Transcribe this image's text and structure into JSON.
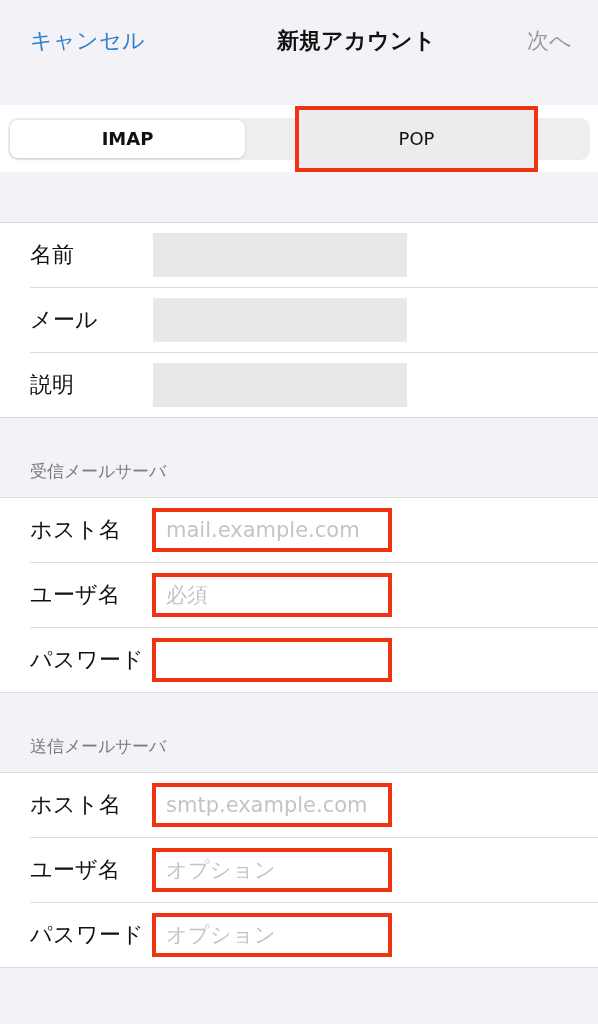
{
  "nav": {
    "cancel": "キャンセル",
    "title": "新規アカウント",
    "next": "次へ",
    "next_disabled": true
  },
  "segments": [
    {
      "label": "IMAP",
      "selected": true,
      "highlighted": false
    },
    {
      "label": "POP",
      "selected": false,
      "highlighted": true
    }
  ],
  "sections": [
    {
      "rows": [
        {
          "label": "名前",
          "redacted": true,
          "highlighted": false
        },
        {
          "label": "メール",
          "redacted": true,
          "highlighted": false
        },
        {
          "label": "説明",
          "redacted": true,
          "highlighted": false
        }
      ]
    },
    {
      "header": "受信メールサーバ",
      "rows": [
        {
          "label": "ホスト名",
          "placeholder": "mail.example.com",
          "highlighted": true
        },
        {
          "label": "ユーザ名",
          "placeholder": "必須",
          "highlighted": true
        },
        {
          "label": "パスワード",
          "highlighted": true
        }
      ]
    },
    {
      "header": "送信メールサーバ",
      "rows": [
        {
          "label": "ホスト名",
          "placeholder": "smtp.example.com",
          "highlighted": true
        },
        {
          "label": "ユーザ名",
          "placeholder": "オプション",
          "highlighted": true
        },
        {
          "label": "パスワード",
          "placeholder": "オプション",
          "highlighted": true
        }
      ]
    }
  ]
}
